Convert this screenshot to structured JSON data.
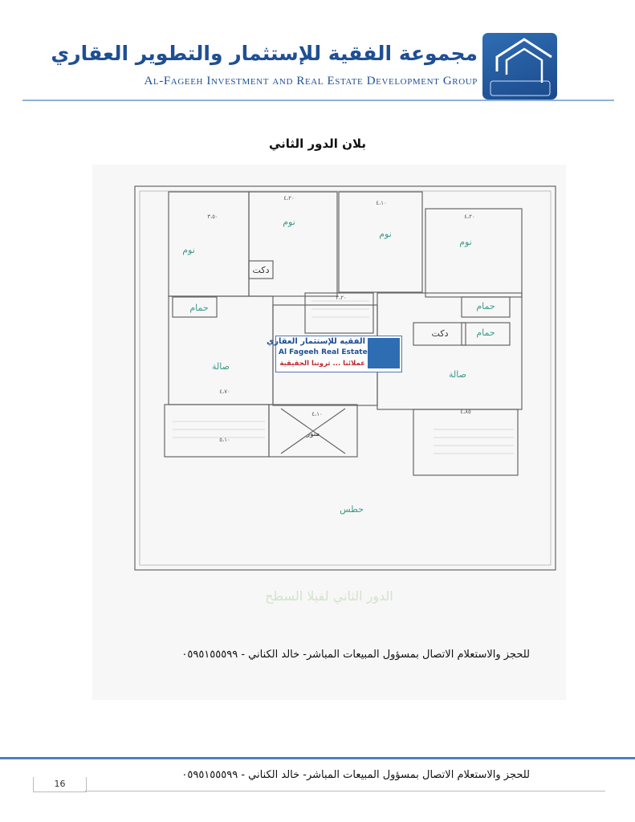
{
  "header": {
    "title_ar": "مجموعة الفقية للإستثمار والتطوير العقاري",
    "title_en": "Al-Fageeh Investment and Real Estate Development Group",
    "logo_text": "الفقيه للإستثمار العقاري"
  },
  "page_title": "بلان الدور الثاني",
  "floor_plan": {
    "rooms": {
      "bedroom": "نوم",
      "duct": "دكت",
      "bathroom": "حمام",
      "hall": "صالة",
      "light_well": "منور",
      "roof": "حطس"
    },
    "dimensions": [
      "٤،٢٠",
      "٣،٥٠",
      "٤،١٠",
      "٤،٢٠",
      "٤،٧٠",
      "٤،٨٥",
      "٥،١٠",
      "٤،١٠",
      "٣،٢٠"
    ],
    "watermark": {
      "line1": "الفقيه للإستثمار العقاري",
      "line2": "Al Fageeh Real Estate",
      "line3": "عملائنا ... ثروتنا الحقيقية"
    },
    "caption": "الدور الثاني لفيلا السطح"
  },
  "contact": "للحجز والاستعلام الاتصال بمسؤول المبيعات المباشر- خالد الكناني   - ٠٥٩٥١٥٥٥٩٩",
  "footer": {
    "contact": "للحجز والاستعلام الاتصال بمسؤول المبيعات المباشر- خالد الكناني   - ٠٥٩٥١٥٥٥٩٩",
    "page_number": "16"
  }
}
